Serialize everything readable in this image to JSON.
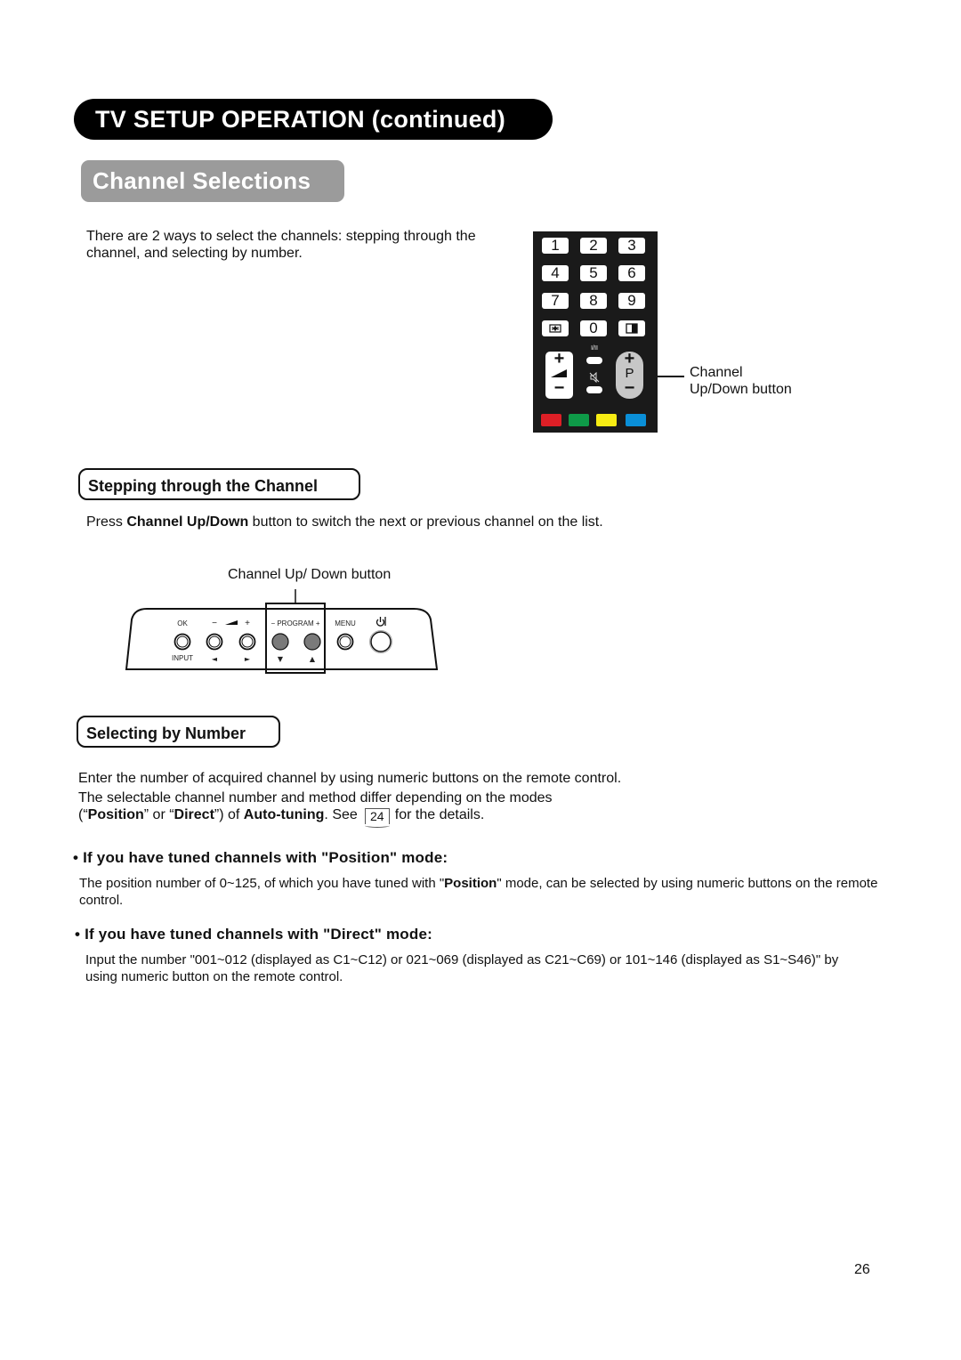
{
  "header": {
    "title": "TV SETUP OPERATION (continued)",
    "section": "Channel Selections"
  },
  "intro": {
    "text": "There are 2 ways to select the channels: stepping through the channel, and selecting by number."
  },
  "remote": {
    "number_keys": [
      "1",
      "2",
      "3",
      "4",
      "5",
      "6",
      "7",
      "8",
      "9",
      "0"
    ],
    "left_function_icon": "text-hold-icon",
    "right_function_icon": "picture-mode-icon",
    "mini_label_top": "I/II",
    "mini_icon_bottom": "mute-icon",
    "volume_plus": "+",
    "volume_minus": "−",
    "program_plus": "+",
    "program_letter": "P",
    "program_minus": "−",
    "color_keys": [
      "#dd1f26",
      "#0e9a48",
      "#f7ec13",
      "#0a8fd8"
    ],
    "callout_line1": "Channel",
    "callout_line2": "Up/Down button"
  },
  "stepping": {
    "heading": "Stepping through the Channel",
    "text_prefix": "Press ",
    "text_bold": "Channel Up/Down",
    "text_suffix": " button to switch the next or previous channel on the list.",
    "diagram_label": "Channel Up/ Down button",
    "panel": {
      "ok": "OK",
      "input": "INPUT",
      "vol_minus": "−",
      "vol_plus": "+",
      "program": "− PROGRAM +",
      "menu": "MENU",
      "left_arrow": "◄",
      "right_arrow": "►",
      "down_arrow": "▼",
      "up_arrow": "▲",
      "power_icon": "power-icon"
    }
  },
  "selecting": {
    "heading": "Selecting by Number",
    "line1": "Enter the number of acquired channel by using numeric buttons on the remote control.",
    "line2": "The selectable channel number and method differ depending on the modes",
    "line3_open": "(“",
    "line3_position": "Position",
    "line3_or": "” or “",
    "line3_direct": "Direct",
    "line3_of": "”) of ",
    "line3_autotuning": "Auto-tuning",
    "line3_see": ". See",
    "page_ref": "24",
    "line3_end": "for the details."
  },
  "position_mode": {
    "bullet": "•",
    "heading": "If you have tuned channels with \"Position\" mode:",
    "text_prefix": "The position number of 0~125, of which you have tuned with \"",
    "text_bold": "Position",
    "text_suffix": "\" mode, can be selected by using numeric buttons on the remote control."
  },
  "direct_mode": {
    "bullet": "•",
    "heading": "If you have tuned channels with \"Direct\" mode:",
    "text": "Input the number \"001~012 (displayed as C1~C12) or 021~069 (displayed as C21~C69) or 101~146 (displayed as S1~S46)\" by using numeric button on the remote control."
  },
  "footer": {
    "page_number": "26"
  }
}
